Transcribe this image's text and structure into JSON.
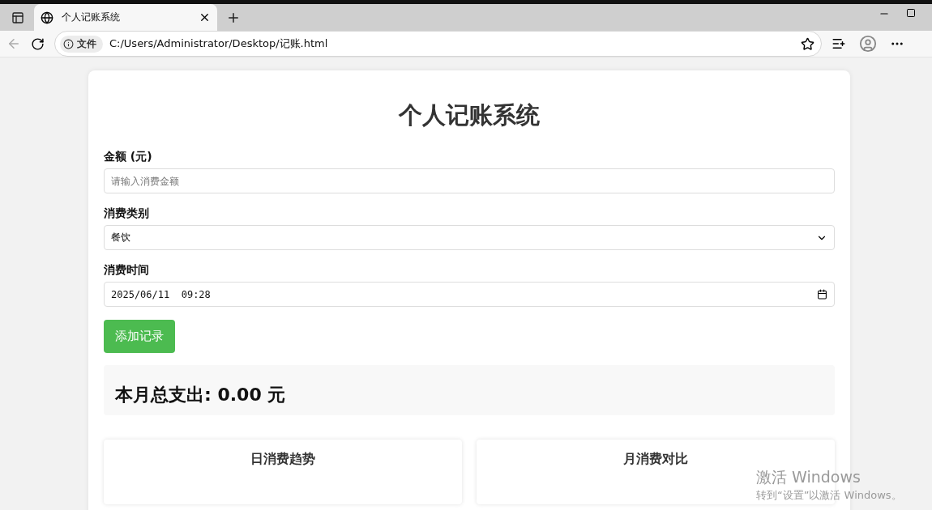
{
  "browser": {
    "tab": {
      "title": "个人记账系统",
      "selected": true
    },
    "address": {
      "badge": "文件",
      "url": "C:/Users/Administrator/Desktop/记账.html"
    }
  },
  "page": {
    "title": "个人记账系统",
    "fields": [
      {
        "kind": "text",
        "label": "金额 (元)",
        "placeholder": "请输入消费金额"
      },
      {
        "kind": "select",
        "label": "消费类别",
        "value": "餐饮"
      },
      {
        "kind": "datetime",
        "label": "消费时间",
        "value": "2025/06/11  09:28"
      }
    ],
    "add_button": "添加记录",
    "summary": "本月总支出: 0.00 元",
    "charts": [
      {
        "title": "日消费趋势"
      },
      {
        "title": "月消费对比"
      }
    ]
  },
  "os_notice": {
    "title": "激活 Windows",
    "text": "转到“设置”以激活 Windows。"
  }
}
